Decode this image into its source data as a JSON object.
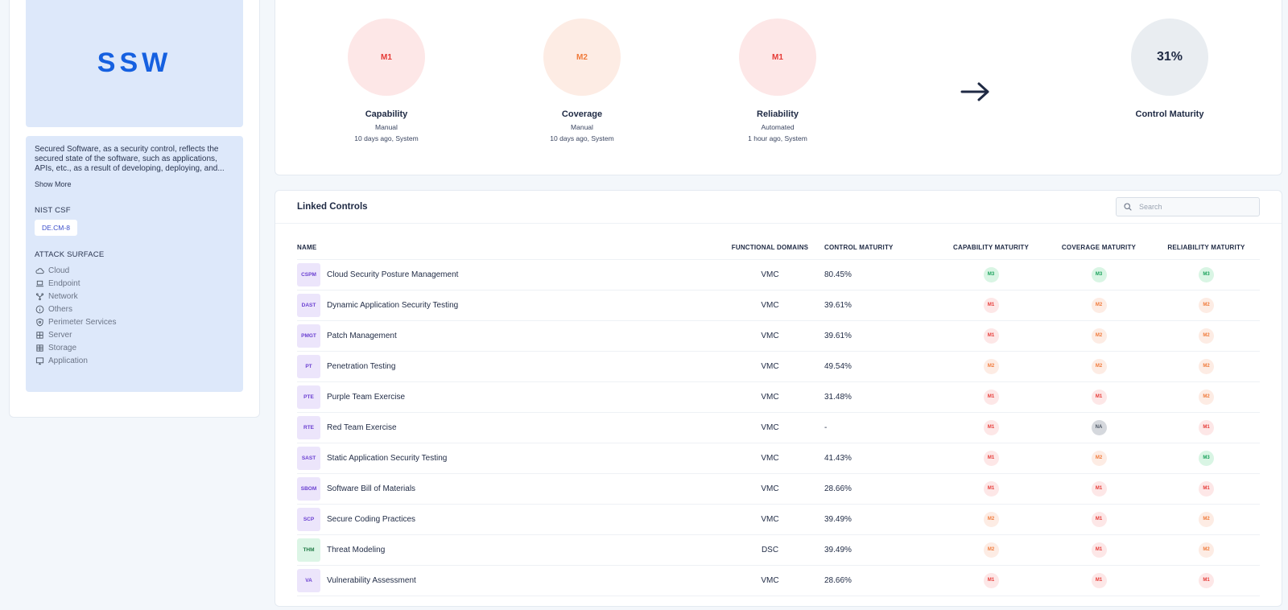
{
  "control": {
    "logo": "SSW",
    "description": "Secured Software, as a security control, reflects the secured state of the software, such as applications, APIs, etc., as a result of developing, deploying, and...",
    "show_more": "Show More",
    "nist_title": "NIST CSF",
    "nist_tag": "DE.CM-8",
    "attack_title": "ATTACK SURFACE",
    "attack_surface": [
      {
        "label": "Cloud",
        "icon": "cloud-icon"
      },
      {
        "label": "Endpoint",
        "icon": "laptop-icon"
      },
      {
        "label": "Network",
        "icon": "network-icon"
      },
      {
        "label": "Others",
        "icon": "info-icon"
      },
      {
        "label": "Perimeter Services",
        "icon": "shield-icon"
      },
      {
        "label": "Server",
        "icon": "server-icon"
      },
      {
        "label": "Storage",
        "icon": "storage-icon"
      },
      {
        "label": "Application",
        "icon": "monitor-icon"
      }
    ]
  },
  "maturity": {
    "capability": {
      "value": "M1",
      "label": "Capability",
      "mode": "Manual",
      "updated": "10 days ago, System"
    },
    "coverage": {
      "value": "M2",
      "label": "Coverage",
      "mode": "Manual",
      "updated": "10 days ago, System"
    },
    "reliability": {
      "value": "M1",
      "label": "Reliability",
      "mode": "Automated",
      "updated": "1 hour ago, System"
    },
    "control": {
      "value": "31%",
      "label": "Control Maturity"
    }
  },
  "linked_controls": {
    "title": "Linked Controls",
    "search_placeholder": "Search",
    "columns": {
      "name": "NAME",
      "functional_domains": "FUNCTIONAL DOMAINS",
      "control_maturity": "CONTROL MATURITY",
      "capability_maturity": "CAPABILITY MATURITY",
      "coverage_maturity": "COVERAGE MATURITY",
      "reliability_maturity": "RELIABILITY MATURITY"
    },
    "rows": [
      {
        "abbr": "CSPM",
        "name": "Cloud Security Posture Management",
        "domain": "VMC",
        "control": "80.45%",
        "cap": "M3",
        "cov": "M3",
        "rel": "M3"
      },
      {
        "abbr": "DAST",
        "name": "Dynamic Application Security Testing",
        "domain": "VMC",
        "control": "39.61%",
        "cap": "M1",
        "cov": "M2",
        "rel": "M2"
      },
      {
        "abbr": "PMGT",
        "name": "Patch Management",
        "domain": "VMC",
        "control": "39.61%",
        "cap": "M1",
        "cov": "M2",
        "rel": "M2"
      },
      {
        "abbr": "PT",
        "name": "Penetration Testing",
        "domain": "VMC",
        "control": "49.54%",
        "cap": "M2",
        "cov": "M2",
        "rel": "M2"
      },
      {
        "abbr": "PTE",
        "name": "Purple Team Exercise",
        "domain": "VMC",
        "control": "31.48%",
        "cap": "M1",
        "cov": "M1",
        "rel": "M2"
      },
      {
        "abbr": "RTE",
        "name": "Red Team Exercise",
        "domain": "VMC",
        "control": "-",
        "cap": "M1",
        "cov": "NA",
        "rel": "M1"
      },
      {
        "abbr": "SAST",
        "name": "Static Application Security Testing",
        "domain": "VMC",
        "control": "41.43%",
        "cap": "M1",
        "cov": "M2",
        "rel": "M3"
      },
      {
        "abbr": "SBOM",
        "name": "Software Bill of Materials",
        "domain": "VMC",
        "control": "28.66%",
        "cap": "M1",
        "cov": "M1",
        "rel": "M1"
      },
      {
        "abbr": "SCP",
        "name": "Secure Coding Practices",
        "domain": "VMC",
        "control": "39.49%",
        "cap": "M2",
        "cov": "M1",
        "rel": "M2"
      },
      {
        "abbr": "THM",
        "name": "Threat Modeling",
        "domain": "DSC",
        "control": "39.49%",
        "cap": "M2",
        "cov": "M1",
        "rel": "M2"
      },
      {
        "abbr": "VA",
        "name": "Vulnerability Assessment",
        "domain": "VMC",
        "control": "28.66%",
        "cap": "M1",
        "cov": "M1",
        "rel": "M1"
      }
    ]
  }
}
